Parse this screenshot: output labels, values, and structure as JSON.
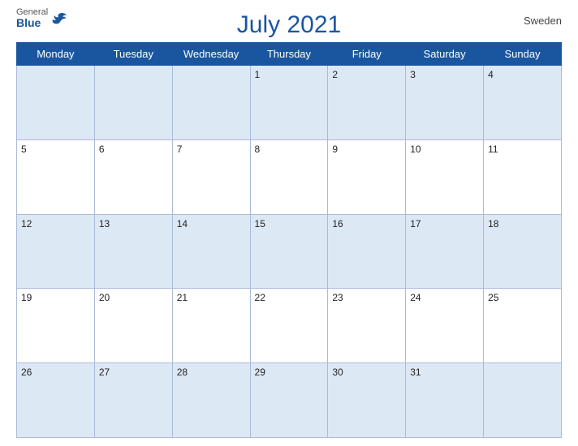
{
  "header": {
    "logo": {
      "general": "General",
      "blue": "Blue"
    },
    "title": "July 2021",
    "country": "Sweden"
  },
  "days": [
    "Monday",
    "Tuesday",
    "Wednesday",
    "Thursday",
    "Friday",
    "Saturday",
    "Sunday"
  ],
  "weeks": [
    [
      "",
      "",
      "",
      "1",
      "2",
      "3",
      "4"
    ],
    [
      "5",
      "6",
      "7",
      "8",
      "9",
      "10",
      "11"
    ],
    [
      "12",
      "13",
      "14",
      "15",
      "16",
      "17",
      "18"
    ],
    [
      "19",
      "20",
      "21",
      "22",
      "23",
      "24",
      "25"
    ],
    [
      "26",
      "27",
      "28",
      "29",
      "30",
      "31",
      ""
    ]
  ]
}
